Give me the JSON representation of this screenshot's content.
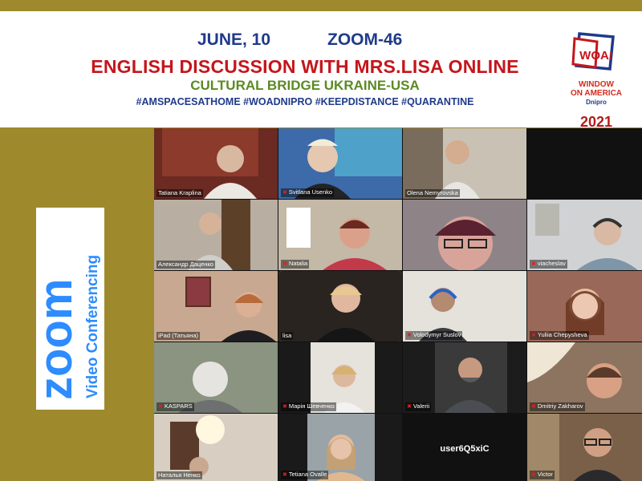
{
  "header": {
    "date": "JUNE, 10",
    "session": "ZOOM-46",
    "title": "ENGLISH DISCUSSION WITH MRS.LISA ONLINE",
    "subtitle": "CULTURAL BRIDGE UKRAINE-USA",
    "hashtags": "#AMSPACESATHOME  #WOADNIPRO #KEEPDISTANCE #QUARANTINE"
  },
  "woa_logo": {
    "mark": "WOA!",
    "line1": "WINDOW",
    "line2": "ON AMERICA",
    "city": "Dnipro",
    "year": "2021"
  },
  "zoom_logo": {
    "word": "zoom",
    "tagline": "Video Conferencing"
  },
  "participants": {
    "p1": "Tatiana Kraplina",
    "p2": "Svitlana Usenko",
    "p3": "Olena Nemyrovska",
    "p4": "Александр Даценко",
    "p5": "Natalia",
    "p7": "viacheslav",
    "p8": "iPad (Татьяна)",
    "p9": "lisa",
    "p10": "Volodymyr Suslov",
    "p11": "Yuliia Chepysheva",
    "p12": "KASPARS",
    "p13": "Марія Шевченко",
    "p14": "Valerii",
    "p15": "Dmitriy Zakharov",
    "p16": "Наталья Ненко",
    "p17": "Tetiana Ovalle",
    "p18": "user6Q5xiC",
    "p19": "Victor"
  },
  "colors": {
    "gold_background": "#9e8a2c",
    "title_red": "#c4161c",
    "header_blue": "#1f3a8a",
    "subtitle_green": "#5b8a22",
    "zoom_blue": "#2d8cff"
  }
}
